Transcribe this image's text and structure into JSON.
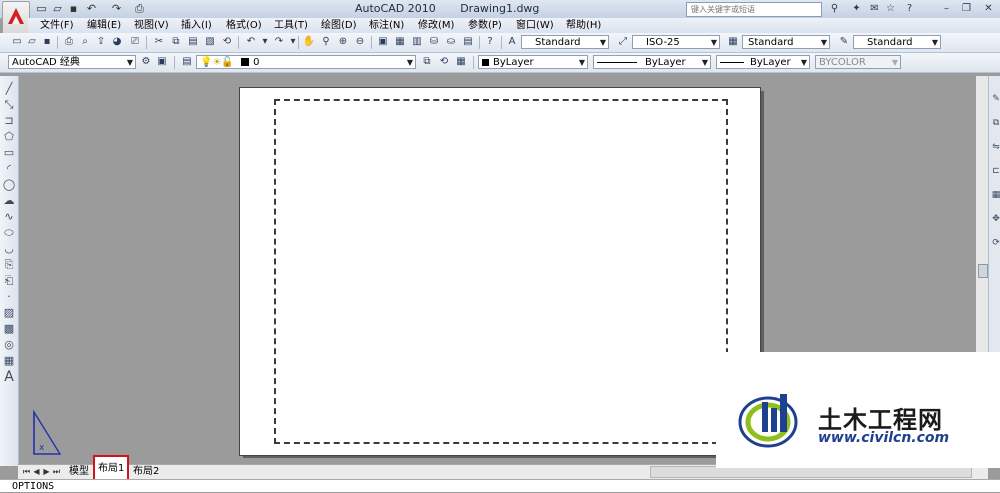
{
  "titlebar": {
    "app_title": "AutoCAD 2010",
    "file_name": "Drawing1.dwg",
    "search_placeholder": "键入关键字或短语"
  },
  "menu": [
    "文件(F)",
    "编辑(E)",
    "视图(V)",
    "插入(I)",
    "格式(O)",
    "工具(T)",
    "绘图(D)",
    "标注(N)",
    "修改(M)",
    "参数(P)",
    "窗口(W)",
    "帮助(H)"
  ],
  "toolbar": {
    "text_style": "Standard",
    "dim_style": "ISO-25",
    "table_style": "Standard",
    "multileader_style": "Standard",
    "workspace": "AutoCAD 经典",
    "layer": "0",
    "color": "ByLayer",
    "linetype": "ByLayer",
    "lineweight": "ByLayer",
    "plot_style": "BYCOLOR"
  },
  "tabs": {
    "model": "模型",
    "layout1": "布局1",
    "layout2": "布局2"
  },
  "command_line": "OPTIONS",
  "watermark": {
    "title": "土木工程网",
    "url": "www.civilcn.com"
  },
  "icons": {
    "app": "autocad-logo-icon",
    "new": "new-file-icon",
    "open": "open-folder-icon",
    "save": "save-icon",
    "undo": "undo-icon",
    "redo": "redo-icon",
    "print": "print-icon"
  },
  "colors": {
    "canvas_bg": "#9b9b9b",
    "highlight": "#d0131d",
    "accent_blue": "#1f3f8f"
  }
}
